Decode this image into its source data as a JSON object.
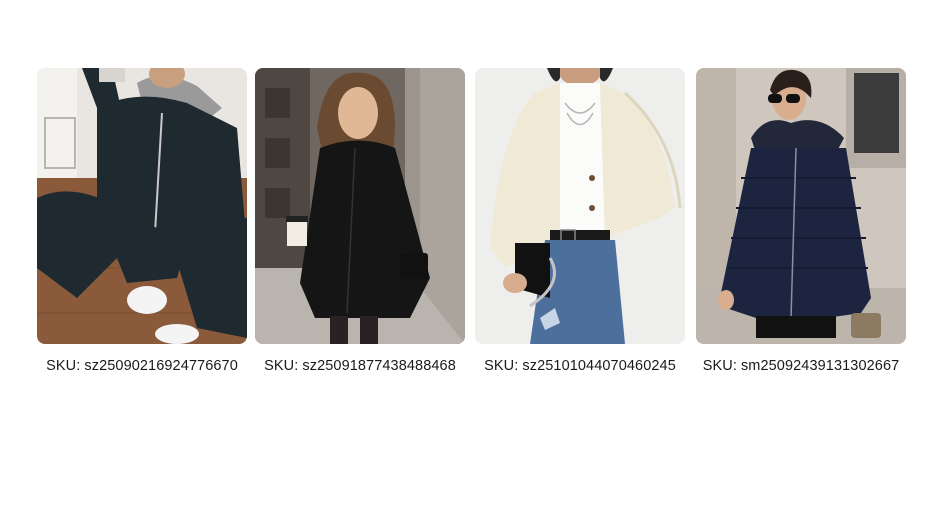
{
  "products": [
    {
      "sku_prefix": "SKU:",
      "sku": "sz25090216924776670",
      "image_subject": "woman-in-black-hooded-zip-sweatsuit-sitting",
      "colors": {
        "bg": "#e9e6e1",
        "floor": "#8a5a3a",
        "garment": "#1f2a30",
        "accent": "#9a9a9a"
      }
    },
    {
      "sku_prefix": "SKU:",
      "sku": "sz25091877438488468",
      "image_subject": "woman-in-black-parka-jacket-with-coffee-on-street",
      "colors": {
        "bg": "#6f6760",
        "floor": "#b9b4ad",
        "garment": "#151515",
        "accent": "#d9c2a6"
      }
    },
    {
      "sku_prefix": "SKU:",
      "sku": "sz25101044070460245",
      "image_subject": "woman-in-cream-fleece-jacket-and-jeans",
      "colors": {
        "bg": "#eeeeec",
        "floor": "#eeeeec",
        "garment": "#efe9d6",
        "accent": "#4d6f9c"
      }
    },
    {
      "sku_prefix": "SKU:",
      "sku": "sm25092439131302667",
      "image_subject": "woman-in-navy-puffer-jacket-with-fur-hood",
      "colors": {
        "bg": "#cfc6bd",
        "floor": "#bdb4ab",
        "garment": "#1c2440",
        "accent": "#3b3b3b"
      }
    }
  ]
}
